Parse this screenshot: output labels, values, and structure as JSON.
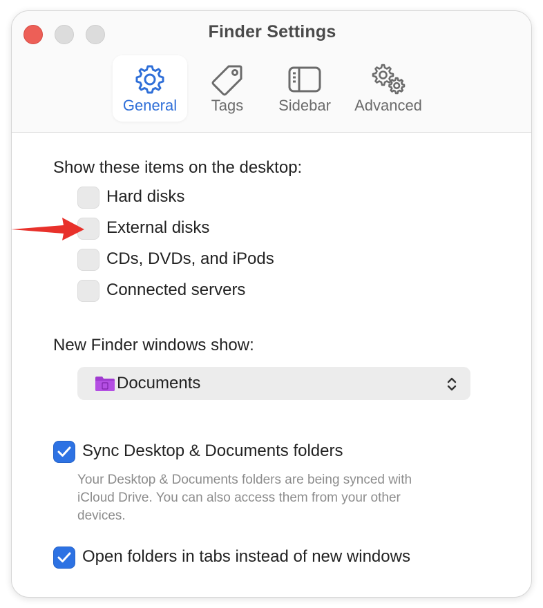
{
  "window": {
    "title": "Finder Settings"
  },
  "tabs": [
    {
      "label": "General",
      "icon": "gear-icon",
      "active": true
    },
    {
      "label": "Tags",
      "icon": "tag-icon",
      "active": false
    },
    {
      "label": "Sidebar",
      "icon": "sidebar-icon",
      "active": false
    },
    {
      "label": "Advanced",
      "icon": "gears-icon",
      "active": false
    }
  ],
  "desktop": {
    "heading": "Show these items on the desktop:",
    "items": [
      {
        "label": "Hard disks",
        "checked": false
      },
      {
        "label": "External disks",
        "checked": false
      },
      {
        "label": "CDs, DVDs, and iPods",
        "checked": false
      },
      {
        "label": "Connected servers",
        "checked": false
      }
    ]
  },
  "new_windows": {
    "heading": "New Finder windows show:",
    "selected": "Documents",
    "folder_color": "#a03ad0"
  },
  "sync": {
    "label": "Sync Desktop & Documents folders",
    "checked": true,
    "help": "Your Desktop & Documents folders are being synced with iCloud Drive. You can also access them from your other devices."
  },
  "tabs_option": {
    "label": "Open folders in tabs instead of new windows",
    "checked": true
  },
  "colors": {
    "accent": "#2d72e3",
    "close": "#ed5f57",
    "annotation_arrow": "#e8312b"
  }
}
